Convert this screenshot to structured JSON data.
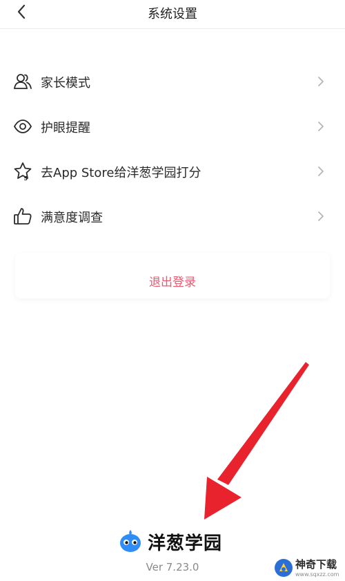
{
  "header": {
    "title": "系统设置",
    "back_icon": "chevron-left-icon"
  },
  "settings": [
    {
      "id": "parent-mode",
      "label": "家长模式",
      "icon": "people-icon"
    },
    {
      "id": "eye-care",
      "label": "护眼提醒",
      "icon": "eye-icon"
    },
    {
      "id": "rate-app",
      "label": "去App Store给洋葱学园打分",
      "icon": "star-five-icon"
    },
    {
      "id": "survey",
      "label": "满意度调查",
      "icon": "thumbs-up-icon"
    }
  ],
  "logout": {
    "label": "退出登录"
  },
  "brand": {
    "name": "洋葱学园",
    "version": "Ver 7.23.0"
  },
  "watermark": {
    "name": "神奇下载",
    "url": "www.sqxzz.com"
  },
  "colors": {
    "logout_text": "#ec5870",
    "annotation_arrow": "#e8232e",
    "brand_blue": "#2f8df5"
  }
}
